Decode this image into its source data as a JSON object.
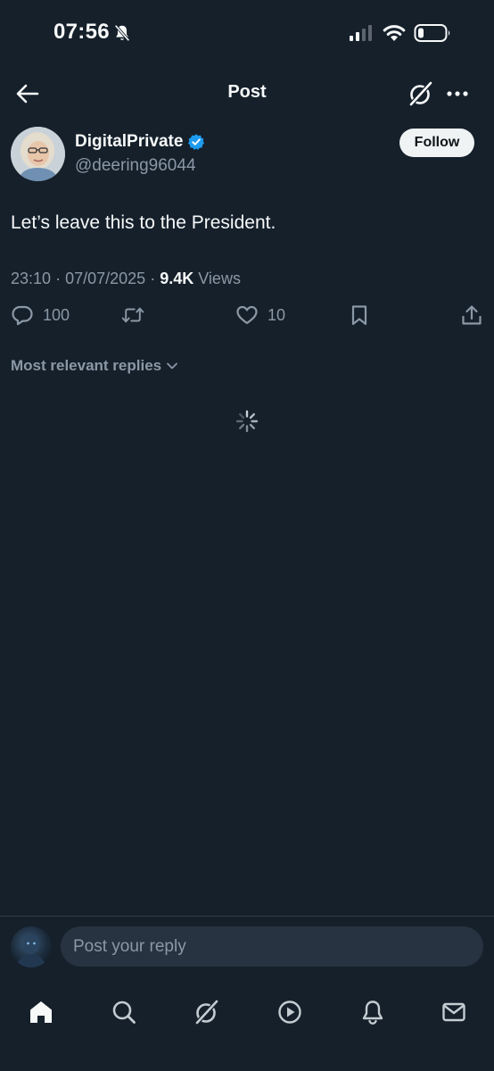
{
  "status_bar": {
    "time": "07:56"
  },
  "header": {
    "title": "Post"
  },
  "post": {
    "author": {
      "name": "DigitalPrivate",
      "handle": "@deering96044",
      "verified": true,
      "follow_label": "Follow"
    },
    "text": "Let’s leave this to the President.",
    "time": "23:10",
    "date": "07/07/2025",
    "separator": "·",
    "views_count": "9.4K",
    "views_label": "Views",
    "actions": {
      "replies": "100",
      "likes": "10"
    }
  },
  "replies_section": {
    "sort_label": "Most relevant replies"
  },
  "reply_bar": {
    "placeholder": "Post your reply"
  },
  "nav": [
    {
      "icon": "home-icon",
      "active": true
    },
    {
      "icon": "search-icon",
      "active": false
    },
    {
      "icon": "grok-icon",
      "active": false
    },
    {
      "icon": "video-icon",
      "active": false
    },
    {
      "icon": "notifications-icon",
      "active": false
    },
    {
      "icon": "messages-icon",
      "active": false
    }
  ],
  "colors": {
    "background": "#15202b",
    "text_primary": "#f7f9f9",
    "text_secondary": "#8b98a5",
    "verified_blue": "#1d9bf0",
    "input_background": "#273340"
  }
}
